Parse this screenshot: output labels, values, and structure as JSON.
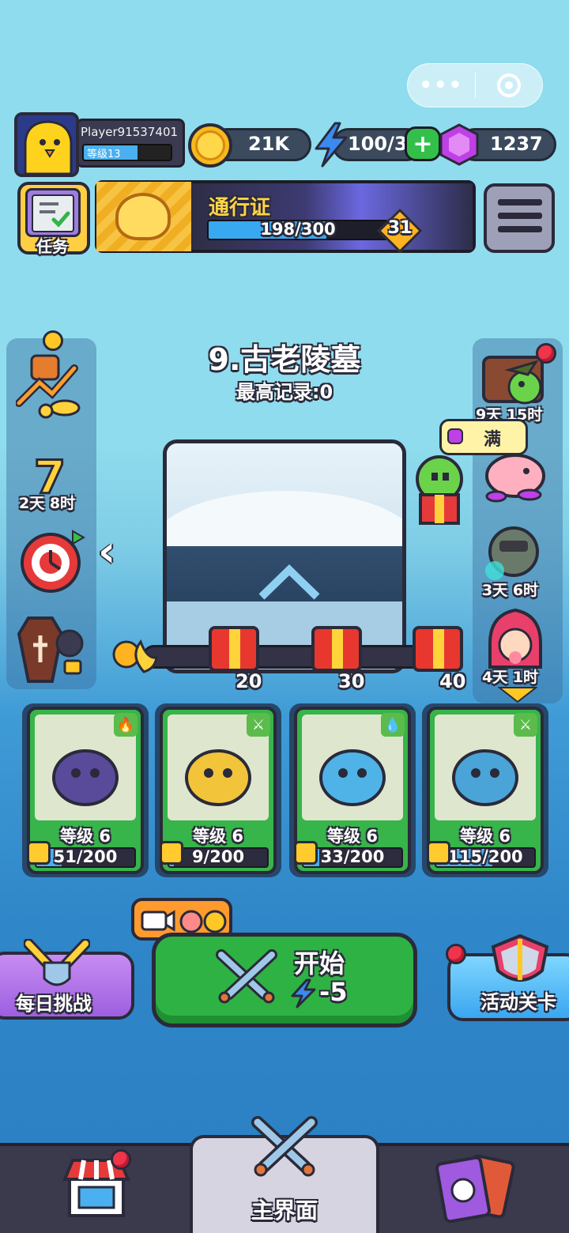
{
  "capsule": {
    "more_icon": "more-dots-icon",
    "close_icon": "target-circle-icon"
  },
  "player": {
    "name": "Player91537401",
    "level_label": "等级13"
  },
  "resources": {
    "coins": "21K",
    "energy": "100/30",
    "gems": "1237",
    "add_icon": "plus-icon"
  },
  "tasks": {
    "label": "任务"
  },
  "battle_pass": {
    "title": "通行证",
    "progress": "198/300",
    "progress_fraction": 0.66,
    "level": "31"
  },
  "left_side": {
    "timer_1": "2天 8时"
  },
  "right_side": {
    "timer_1": "9天 15时",
    "bubble_text": "满",
    "timer_2": "3天 6时",
    "timer_3": "4天 1时"
  },
  "stage": {
    "title": "9.古老陵墓",
    "record": "最高记录:0"
  },
  "rewards": [
    {
      "label": "20"
    },
    {
      "label": "30"
    },
    {
      "label": "40"
    }
  ],
  "cards": [
    {
      "level": "等级 6",
      "progress": "51/200",
      "fraction": 0.255,
      "element_icon": "fire-icon",
      "art_color": "#5a4a9a"
    },
    {
      "level": "等级 6",
      "progress": "9/200",
      "fraction": 0.045,
      "element_icon": "sword-icon",
      "art_color": "#f2c43a"
    },
    {
      "level": "等级 6",
      "progress": "33/200",
      "fraction": 0.165,
      "element_icon": "water-drop-icon",
      "art_color": "#4fb3e8"
    },
    {
      "level": "等级 6",
      "progress": "115/200",
      "fraction": 0.575,
      "element_icon": "sword-icon",
      "art_color": "#4aa4d8"
    }
  ],
  "buttons": {
    "start": "开始",
    "start_cost": "-5",
    "daily": "每日挑战",
    "event": "活动关卡"
  },
  "nav": {
    "main": "主界面"
  }
}
